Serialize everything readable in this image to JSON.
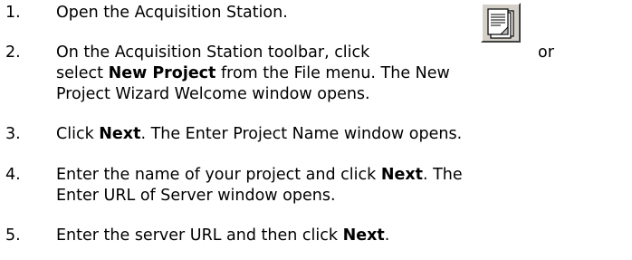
{
  "steps": [
    {
      "number": "1.",
      "lines": [
        "Open the Acquisition Station."
      ]
    },
    {
      "number": "2.",
      "line1_before": "On the Acquisition Station toolbar, click",
      "line1_after": "or",
      "line2_pre": "select ",
      "line2_bold": "New Project",
      "line2_post": " from the File menu. The New",
      "line3": "Project Wizard Welcome window opens.",
      "icon": "new-project-document-icon"
    },
    {
      "number": "3.",
      "pre": "Click ",
      "bold": "Next",
      "post": ". The Enter Project Name window opens."
    },
    {
      "number": "4.",
      "line1_pre": "Enter the name of your project and click ",
      "line1_bold": "Next",
      "line1_post": ". The",
      "line2": "Enter URL of Server window opens."
    },
    {
      "number": "5.",
      "pre": "Enter the server URL and then click ",
      "bold": "Next",
      "post": "."
    }
  ]
}
